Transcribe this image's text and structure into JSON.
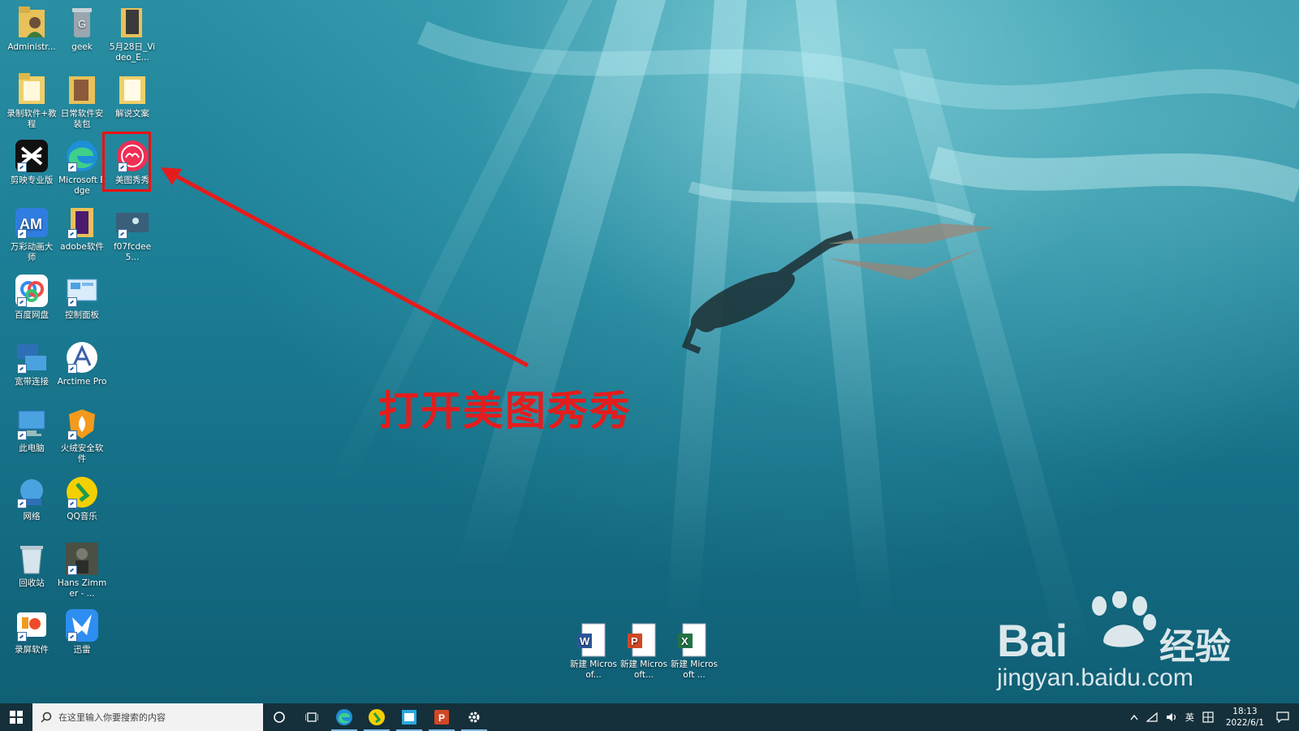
{
  "desktop": {
    "icons": [
      {
        "label": "Administr...",
        "name": "icon-administrator"
      },
      {
        "label": "geek",
        "name": "icon-geek"
      },
      {
        "label": "5月28日_Video_E...",
        "name": "icon-video-folder"
      },
      {
        "label": "录制软件+教程",
        "name": "icon-recording-folder"
      },
      {
        "label": "日常软件安装包",
        "name": "icon-software-folder"
      },
      {
        "label": "解说文案",
        "name": "icon-script-folder"
      },
      {
        "label": "剪映专业版",
        "name": "icon-jianying"
      },
      {
        "label": "Microsoft Edge",
        "name": "icon-edge"
      },
      {
        "label": "美图秀秀",
        "name": "icon-meitu"
      },
      {
        "label": "万彩动画大师",
        "name": "icon-am"
      },
      {
        "label": "adobe软件",
        "name": "icon-adobe"
      },
      {
        "label": "f07fcdee5...",
        "name": "icon-image-file"
      },
      {
        "label": "百度网盘",
        "name": "icon-baidu-netdisk"
      },
      {
        "label": "控制面板",
        "name": "icon-control-panel"
      },
      {
        "label": "宽带连接",
        "name": "icon-broadband"
      },
      {
        "label": "Arctime Pro",
        "name": "icon-arctime"
      },
      {
        "label": "此电脑",
        "name": "icon-this-pc"
      },
      {
        "label": "火绒安全软件",
        "name": "icon-huorong"
      },
      {
        "label": "网络",
        "name": "icon-network"
      },
      {
        "label": "QQ音乐",
        "name": "icon-qqmusic"
      },
      {
        "label": "回收站",
        "name": "icon-recycle-bin"
      },
      {
        "label": "Hans Zimmer - ...",
        "name": "icon-hans-zimmer"
      },
      {
        "label": "录屏软件",
        "name": "icon-screen-recorder"
      },
      {
        "label": "迅雷",
        "name": "icon-xunlei"
      }
    ],
    "bottom_icons": [
      {
        "label": "新建 Microsof...",
        "name": "icon-new-word"
      },
      {
        "label": "新建 Microsoft...",
        "name": "icon-new-ppt"
      },
      {
        "label": "新建 Microsoft ...",
        "name": "icon-new-excel"
      }
    ]
  },
  "annotation": {
    "text": "打开美图秀秀",
    "color": "#e51c1c"
  },
  "watermark": {
    "brand": "Bai",
    "brand_suffix": "经验",
    "url": "jingyan.baidu.com"
  },
  "taskbar": {
    "search_placeholder": "在这里输入你要搜索的内容",
    "tray_ime": "英",
    "time": "18:13",
    "date": "2022/6/1"
  }
}
